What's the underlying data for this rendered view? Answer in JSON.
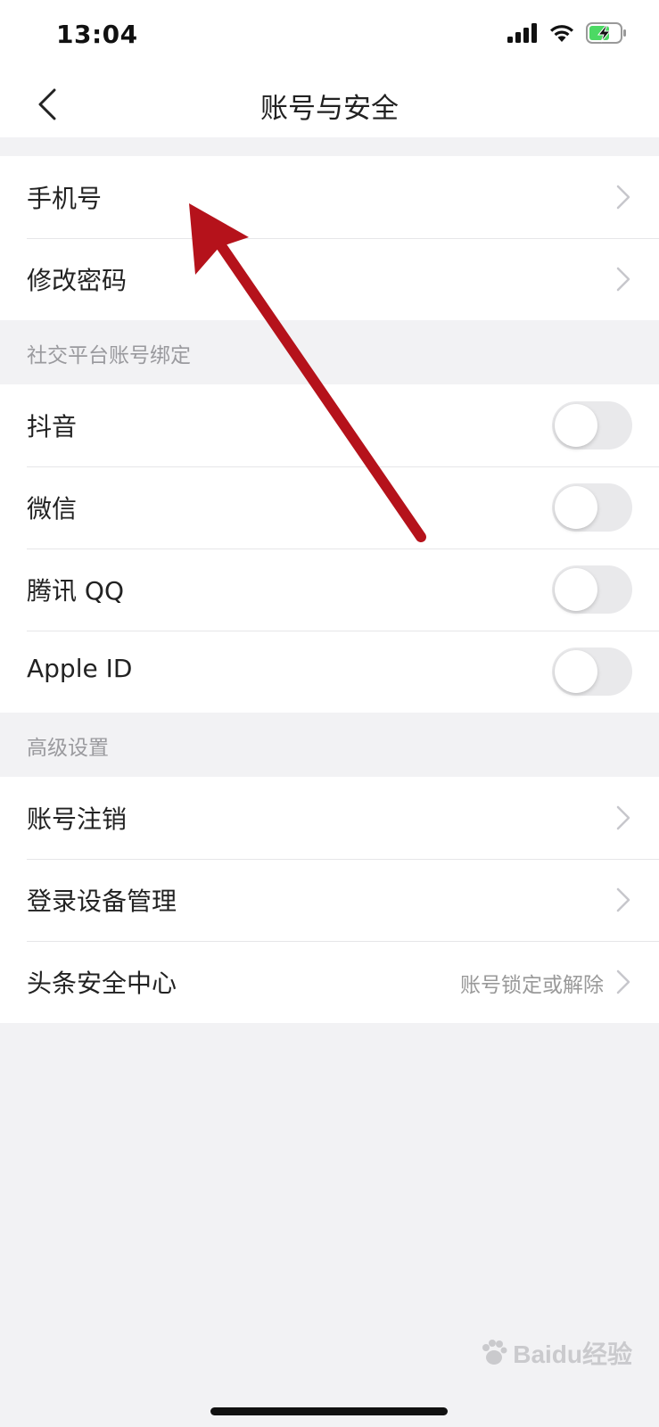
{
  "status_bar": {
    "time": "13:04"
  },
  "nav": {
    "title": "账号与安全"
  },
  "account_group": [
    {
      "label": "手机号"
    },
    {
      "label": "修改密码"
    }
  ],
  "social_section": {
    "header": "社交平台账号绑定",
    "items": [
      {
        "label": "抖音",
        "enabled": false
      },
      {
        "label": "微信",
        "enabled": false
      },
      {
        "label": "腾讯 QQ",
        "enabled": false
      },
      {
        "label": "Apple ID",
        "enabled": false
      }
    ]
  },
  "advanced_section": {
    "header": "高级设置",
    "items": [
      {
        "label": "账号注销",
        "value": ""
      },
      {
        "label": "登录设备管理",
        "value": ""
      },
      {
        "label": "头条安全中心",
        "value": "账号锁定或解除"
      }
    ]
  },
  "watermark": {
    "text": "Baidu经验"
  },
  "colors": {
    "arrow": "#b5121b",
    "toggle_off": "#e9e9eb",
    "battery": "#4cd964"
  },
  "icons": [
    "cellular-signal-icon",
    "wifi-icon",
    "battery-charging-icon",
    "back-chevron-icon",
    "chevron-right-icon"
  ]
}
